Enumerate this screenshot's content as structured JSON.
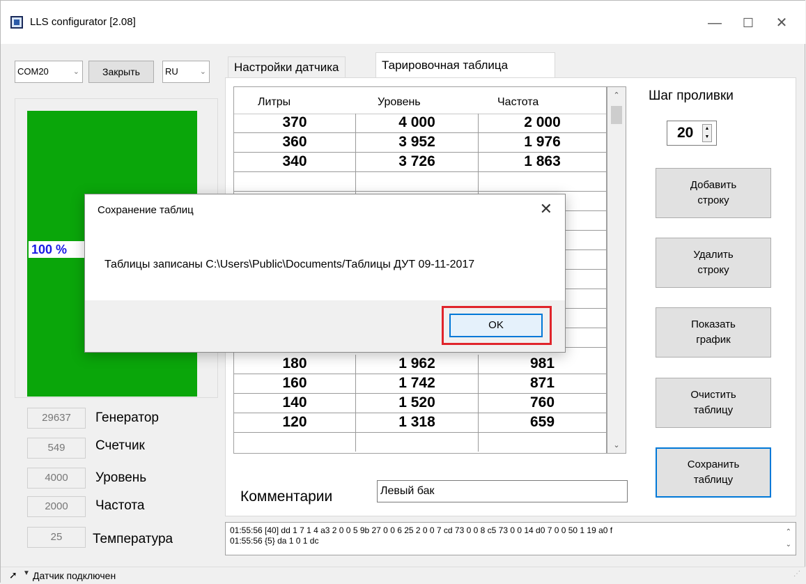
{
  "window": {
    "title": "LLS configurator [2.08]"
  },
  "toolbar": {
    "port": "COM20",
    "close_label": "Закрыть",
    "language": "RU"
  },
  "gauge": {
    "percent_label": "100 %",
    "fill_percent": 100,
    "color": "#0aa60a"
  },
  "stats": [
    {
      "value": "29637",
      "label": "Генератор"
    },
    {
      "value": "549",
      "label": "Счетчик"
    },
    {
      "value": "4000",
      "label": "Уровень"
    },
    {
      "value": "2000",
      "label": "Частота"
    },
    {
      "value": "25",
      "label": "Температура"
    }
  ],
  "tabs": {
    "sensor_settings": "Настройки датчика",
    "calibration_table": "Тарировочная таблица"
  },
  "table": {
    "headers": [
      "Литры",
      "Уровень",
      "Частота"
    ],
    "rows": [
      [
        "370",
        "4 000",
        "2 000"
      ],
      [
        "360",
        "3 952",
        "1 976"
      ],
      [
        "340",
        "3 726",
        "1 863"
      ],
      [
        "180",
        "1 962",
        "981"
      ],
      [
        "160",
        "1 742",
        "871"
      ],
      [
        "140",
        "1 520",
        "760"
      ],
      [
        "120",
        "1 318",
        "659"
      ]
    ]
  },
  "side": {
    "step_label": "Шаг проливки",
    "step_value": "20",
    "add_row_l1": "Добавить",
    "add_row_l2": "строку",
    "del_row_l1": "Удалить",
    "del_row_l2": "строку",
    "show_graph_l1": "Показать",
    "show_graph_l2": "график",
    "clear_l1": "Очистить",
    "clear_l2": "таблицу",
    "save_l1": "Сохранить",
    "save_l2": "таблицу"
  },
  "comment": {
    "label": "Комментарии",
    "value": "Левый бак"
  },
  "log": {
    "line1": "01:55:56 [40]  dd 1 7 1 4 a3 2 0 0 5 9b 27 0 0 6 25 2 0 0 7 cd 73 0 0 8 c5 73 0 0 14 d0 7 0 0 50 1 19 a0 f",
    "line2": "01:55:56 {5}  da 1 0 1 dc"
  },
  "status": {
    "text": "Датчик подключен"
  },
  "dialog": {
    "title": "Сохранение таблиц",
    "message": "Таблицы записаны C:\\Users\\Public\\Documents/Таблицы ДУТ 09-11-2017",
    "ok_label": "OK",
    "highlight_color": "#e0242b"
  }
}
